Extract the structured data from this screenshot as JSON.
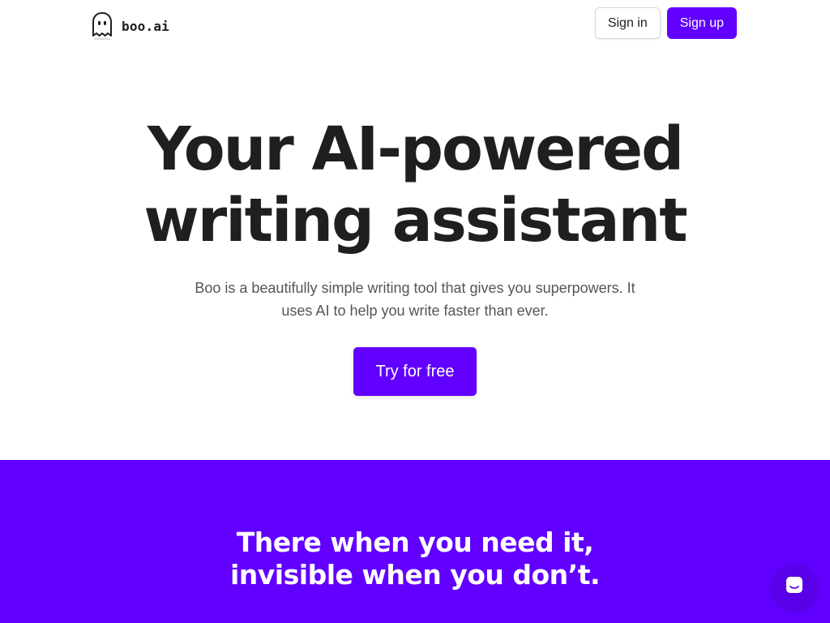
{
  "header": {
    "logo_icon": "ghost-icon",
    "logo_text": "boo.ai",
    "signin_label": "Sign in",
    "signup_label": "Sign up"
  },
  "hero": {
    "title_line1": "Your AI-powered",
    "title_line2": "writing assistant",
    "subtitle_line1": "Boo is a beautifully simple writing tool that gives you superpowers. It",
    "subtitle_line2": "uses AI to help you write faster than ever.",
    "cta_label": "Try for free"
  },
  "band": {
    "title_line1": "There when you need it,",
    "title_line2": "invisible when you don’t."
  },
  "chat": {
    "icon": "chat-bubble-icon"
  },
  "colors": {
    "accent": "#6100ff",
    "text": "#1f1f1f",
    "muted": "#555555"
  }
}
